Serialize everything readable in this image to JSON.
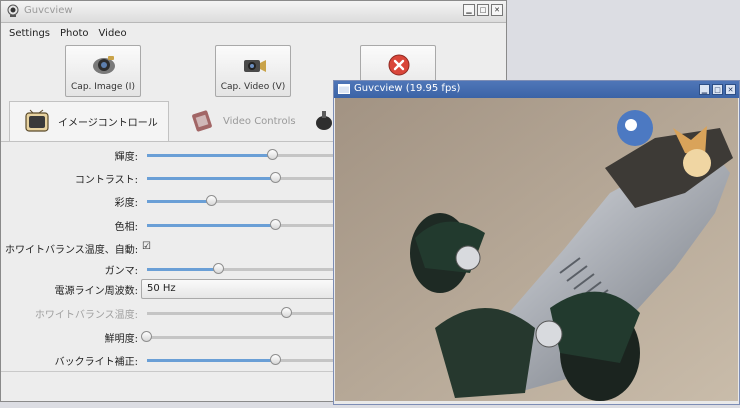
{
  "main_window": {
    "title": "Guvcview",
    "menu": [
      "Settings",
      "Photo",
      "Video"
    ],
    "toolbar": {
      "cap_image_label": "Cap. Image (I)",
      "cap_video_label": "Cap. Video (V)"
    },
    "tabs": {
      "image_controls": "イメージコントロール",
      "video_controls": "Video Controls"
    },
    "controls": [
      {
        "label": "輝度",
        "type": "slider",
        "value": 0.35
      },
      {
        "label": "コントラスト",
        "type": "slider",
        "value": 0.36
      },
      {
        "label": "彩度",
        "type": "slider",
        "value": 0.18
      },
      {
        "label": "色相",
        "type": "slider",
        "value": 0.36
      },
      {
        "label": "ホワイトバランス温度、自動",
        "type": "checkbox",
        "checked": true
      },
      {
        "label": "ガンマ",
        "type": "slider",
        "value": 0.2
      },
      {
        "label": "電源ライン周波数",
        "type": "dropdown",
        "selected": "50 Hz"
      },
      {
        "label": "ホワイトバランス温度",
        "type": "slider",
        "value": 0.39,
        "disabled": true
      },
      {
        "label": "鮮明度",
        "type": "slider",
        "value": 0.0
      },
      {
        "label": "バックライト補正",
        "type": "slider",
        "value": 0.36
      }
    ]
  },
  "preview_window": {
    "title": "Guvcview  (19.95 fps)"
  },
  "colors": {
    "accent": "#6a9fd6",
    "preview_titlebar": "#3b63a6",
    "disabled_text": "#a0a0a0"
  }
}
